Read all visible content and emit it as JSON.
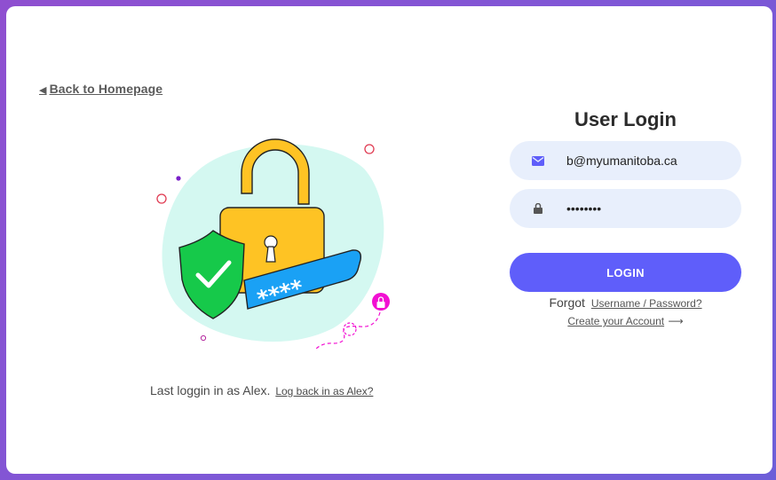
{
  "nav": {
    "back_label": "Back to Homepage"
  },
  "last_login": {
    "text": "Last loggin in as Alex.",
    "relogin_link": "Log back in as Alex?"
  },
  "login": {
    "title": "User Login",
    "email_value": "b@myumanitoba.ca",
    "password_value": "••••••••",
    "button_label": "LOGIN",
    "forgot_prefix": "Forgot",
    "forgot_link": "Username / Password?",
    "create_link": "Create your Account"
  },
  "illustration": {
    "password_mask": "****"
  },
  "icons": [
    "triangle-left-icon",
    "email-icon",
    "lock-icon",
    "arrow-right-icon",
    "padlock-illustration",
    "shield-check-icon"
  ],
  "colors": {
    "background_gradient_start": "#8f4fd0",
    "background_gradient_end": "#6d5ed8",
    "accent": "#5f5efa",
    "field_bg": "#e8effc",
    "blob": "#d4f8f1",
    "padlock": "#fec324",
    "shield": "#16c94a",
    "password_bar": "#1aa1f5",
    "magenta": "#f20fd2"
  }
}
